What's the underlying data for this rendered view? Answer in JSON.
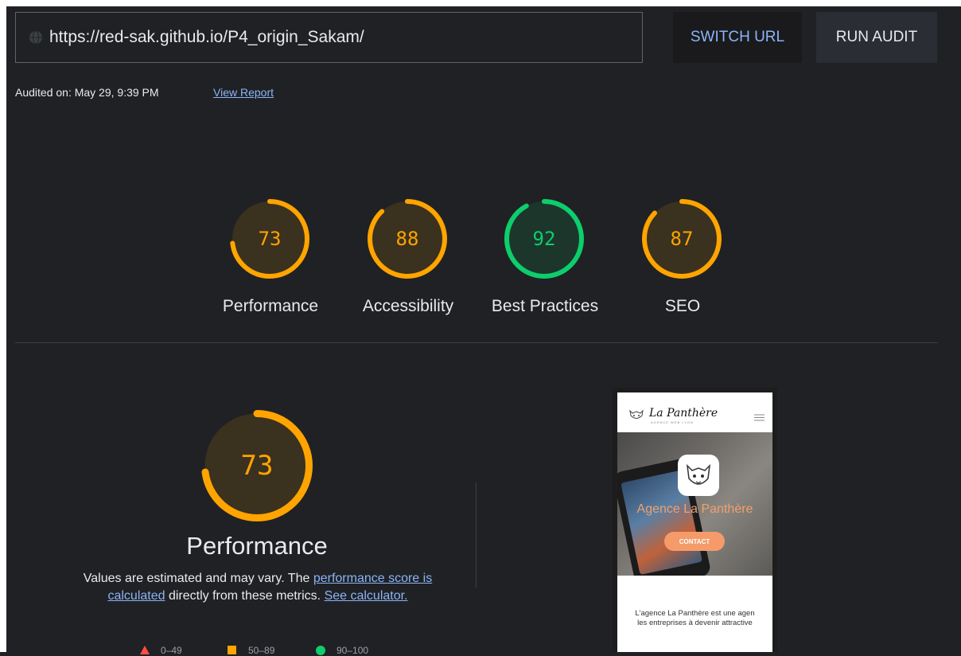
{
  "toolbar": {
    "url": "https://red-sak.github.io/P4_origin_Sakam/",
    "switch_url_label": "SWITCH URL",
    "run_audit_label": "RUN AUDIT"
  },
  "audit_info": {
    "audited_on": "Audited on: May 29, 9:39 PM",
    "view_report_label": "View Report"
  },
  "scores": [
    {
      "label": "Performance",
      "score": "73",
      "color": "#ffa400"
    },
    {
      "label": "Accessibility",
      "score": "88",
      "color": "#ffa400"
    },
    {
      "label": "Best Practices",
      "score": "92",
      "color": "#0cce6b"
    },
    {
      "label": "SEO",
      "score": "87",
      "color": "#ffa400"
    }
  ],
  "detail": {
    "score": "73",
    "title": "Performance",
    "desc_prefix": "Values are estimated and may vary. The ",
    "desc_link1": "performance score is calculated",
    "desc_mid": " directly from these metrics. ",
    "desc_link2": "See calculator.",
    "legend": [
      {
        "range": "0–49",
        "color": "#ff4e42",
        "icon": "triangle-icon"
      },
      {
        "range": "50–89",
        "color": "#ffa400",
        "icon": "square-icon"
      },
      {
        "range": "90–100",
        "color": "#0cce6b",
        "icon": "circle-icon"
      }
    ]
  },
  "screenshot": {
    "site_name": "La Panthère",
    "site_tagline": "AGENCE WEB LYON",
    "hero_title": "Agence La Panthère",
    "contact_label": "CONTACT",
    "text_line1": "L'agence La Panthère est une agen",
    "text_line2": "les entreprises à devenir attractive"
  },
  "colors": {
    "background": "#202124",
    "pass": "#0cce6b",
    "average": "#ffa400",
    "fail": "#ff4e42",
    "link": "#8ab4f8"
  }
}
